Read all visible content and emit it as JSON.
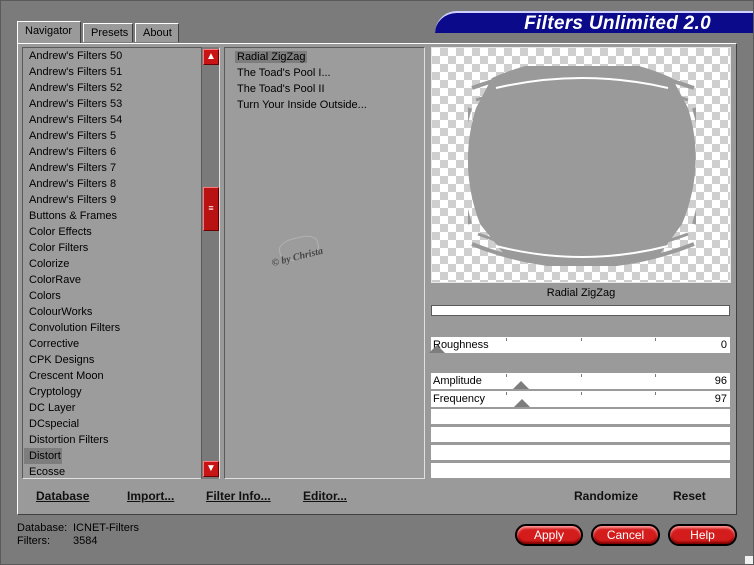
{
  "title": "Filters Unlimited 2.0",
  "tabs": [
    "Navigator",
    "Presets",
    "About"
  ],
  "categories": [
    "Andrew's Filters 50",
    "Andrew's Filters 51",
    "Andrew's Filters 52",
    "Andrew's Filters 53",
    "Andrew's Filters 54",
    "Andrew's Filters 5",
    "Andrew's Filters 6",
    "Andrew's Filters 7",
    "Andrew's Filters 8",
    "Andrew's Filters 9",
    "Buttons & Frames",
    "Color Effects",
    "Color Filters",
    "Colorize",
    "ColorRave",
    "Colors",
    "ColourWorks",
    "Convolution Filters",
    "Corrective",
    "CPK Designs",
    "Crescent Moon",
    "Cryptology",
    "DC Layer",
    "DCspecial",
    "Distortion Filters",
    "Distort",
    "Ecosse"
  ],
  "selected_category": "Distort",
  "filters": [
    "Radial ZigZag",
    "The Toad's Pool I...",
    "The Toad's Pool II",
    "Turn Your Inside Outside..."
  ],
  "selected_filter": "Radial ZigZag",
  "watermark": "© by Christa",
  "preview_label": "Radial ZigZag",
  "params": [
    {
      "label": "Roughness",
      "value": "0",
      "level": 0
    },
    {
      "label": "Amplitude",
      "value": "96",
      "level": 96
    },
    {
      "label": "Frequency",
      "value": "97",
      "level": 97
    }
  ],
  "actions": {
    "database": "Database",
    "import": "Import...",
    "filter_info": "Filter Info...",
    "editor": "Editor...",
    "randomize": "Randomize",
    "reset": "Reset"
  },
  "status": {
    "database_label": "Database:",
    "database_value": "ICNET-Filters",
    "filters_label": "Filters:",
    "filters_value": "3584"
  },
  "buttons": {
    "apply": "Apply",
    "cancel": "Cancel",
    "help": "Help"
  },
  "colors": {
    "banner": "#0a0a8a",
    "button_red": "#d41c1c",
    "panel": "#9a9a9a"
  }
}
